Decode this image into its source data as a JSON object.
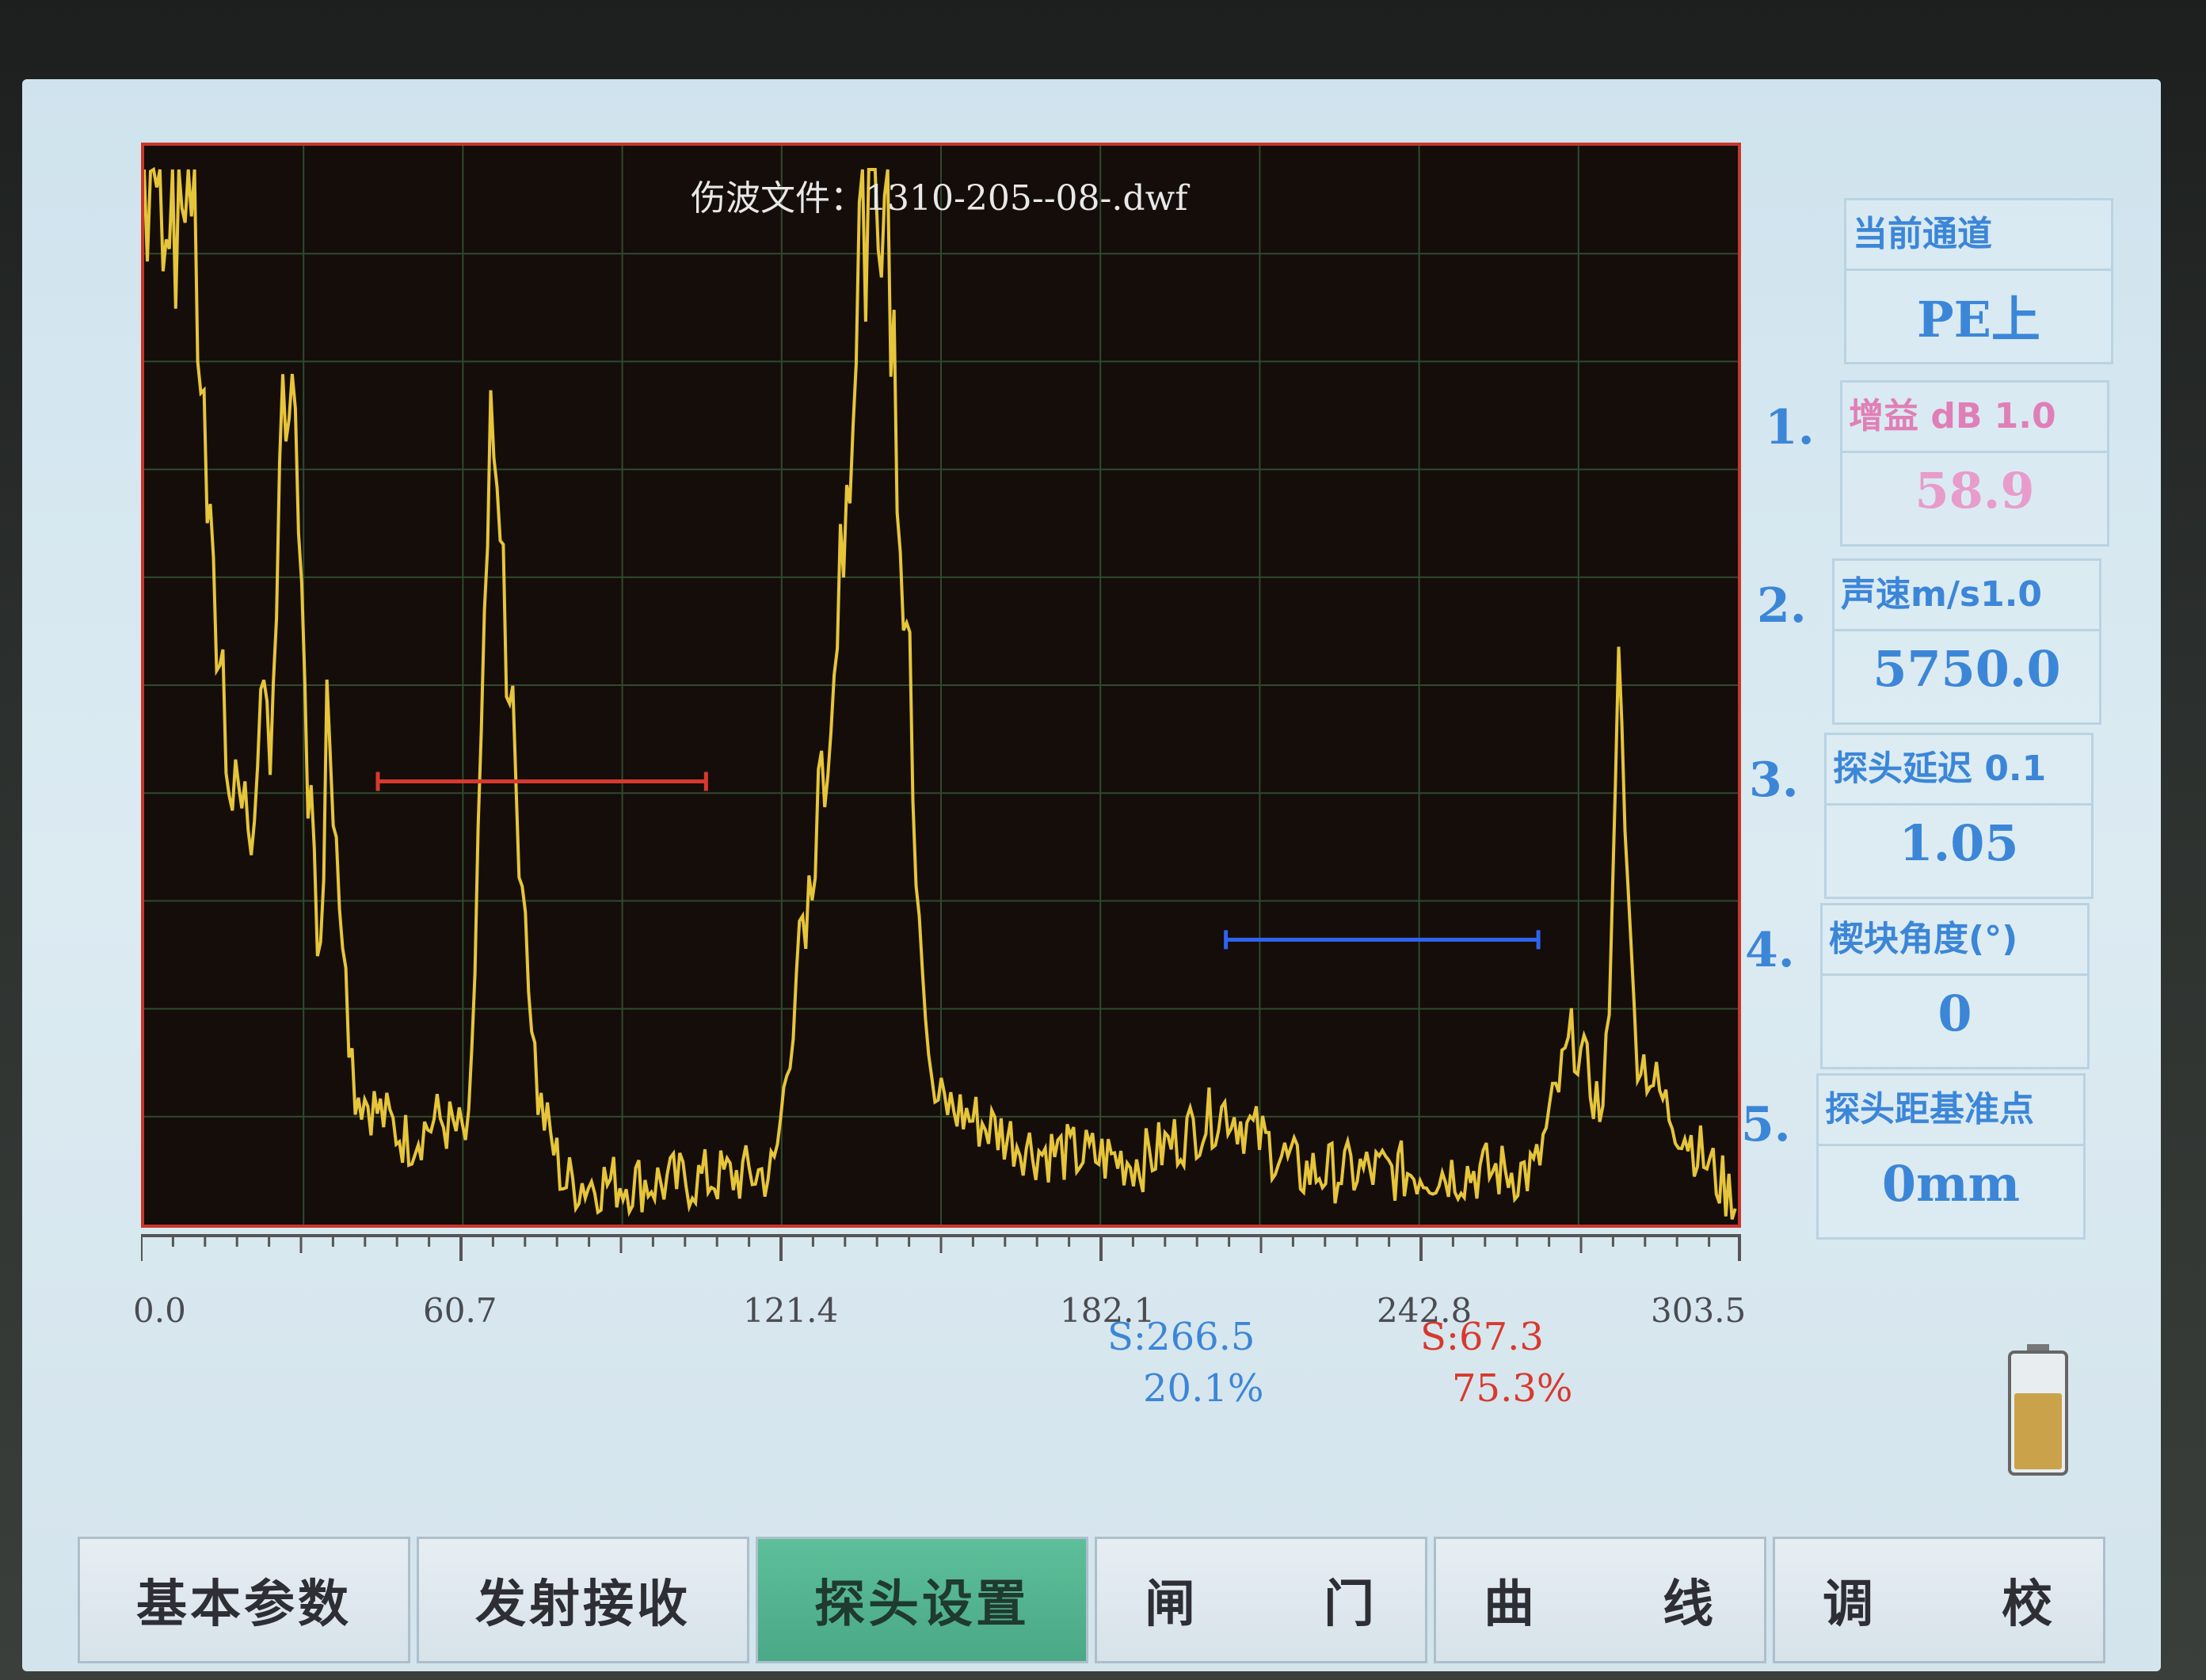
{
  "plot": {
    "file_title": "伤波文件：1310-205--08-.dwf",
    "colors": {
      "background": "#140d0a",
      "grid": "#2f4a2f",
      "trace": "#e6c53a",
      "gate_a": "#d8392e",
      "gate_b": "#2f63f0",
      "border": "#c8372c"
    }
  },
  "chart_data": {
    "type": "line",
    "title": "伤波文件：1310-205--08-.dwf",
    "xlim": [
      0,
      303.5
    ],
    "ylim": [
      0,
      100
    ],
    "ticks": [
      "0.0",
      "60.7",
      "121.4",
      "182.1",
      "242.8",
      "303.5"
    ],
    "peaks": [
      {
        "x": 2,
        "y": 100
      },
      {
        "x": 9,
        "y": 100
      },
      {
        "x": 13,
        "y": 60
      },
      {
        "x": 17,
        "y": 42
      },
      {
        "x": 20,
        "y": 38
      },
      {
        "x": 24,
        "y": 48
      },
      {
        "x": 27,
        "y": 80
      },
      {
        "x": 29,
        "y": 70
      },
      {
        "x": 33,
        "y": 25
      },
      {
        "x": 35,
        "y": 50
      },
      {
        "x": 40,
        "y": 13
      },
      {
        "x": 50,
        "y": 8
      },
      {
        "x": 56,
        "y": 10
      },
      {
        "x": 62,
        "y": 8
      },
      {
        "x": 66,
        "y": 73
      },
      {
        "x": 68,
        "y": 62
      },
      {
        "x": 75,
        "y": 12
      },
      {
        "x": 80,
        "y": 4
      },
      {
        "x": 100,
        "y": 4
      },
      {
        "x": 120,
        "y": 5
      },
      {
        "x": 131,
        "y": 50
      },
      {
        "x": 137,
        "y": 100
      },
      {
        "x": 141,
        "y": 100
      },
      {
        "x": 147,
        "y": 38
      },
      {
        "x": 150,
        "y": 12
      },
      {
        "x": 170,
        "y": 7
      },
      {
        "x": 190,
        "y": 6
      },
      {
        "x": 206,
        "y": 11
      },
      {
        "x": 220,
        "y": 5
      },
      {
        "x": 265,
        "y": 5
      },
      {
        "x": 272,
        "y": 18
      },
      {
        "x": 278,
        "y": 10
      },
      {
        "x": 281,
        "y": 52
      },
      {
        "x": 284,
        "y": 17
      },
      {
        "x": 290,
        "y": 11
      },
      {
        "x": 296,
        "y": 7
      },
      {
        "x": 303,
        "y": 2
      }
    ],
    "gates": [
      {
        "name": "A",
        "color": "#d8392e",
        "start": 44.5,
        "end": 107,
        "level": 42
      },
      {
        "name": "B",
        "color": "#2f63f0",
        "start": 206,
        "end": 265.5,
        "level": 27
      }
    ]
  },
  "readouts": {
    "b_s": "S:266.5",
    "b_pct": "20.1%",
    "a_s": "S:67.3",
    "a_pct": "75.3%",
    "b_color": "#3c86d8",
    "a_color": "#d8392e"
  },
  "panel": {
    "channel_title": "当前通道",
    "channel_value": "PE上",
    "items": [
      {
        "num": "1.",
        "title": "增益 dB 1.0",
        "value": "58.9",
        "title_color": "#e07fb7",
        "value_color": "#e89ccb"
      },
      {
        "num": "2.",
        "title": "声速m/s1.0",
        "value": "5750.0",
        "title_color": "#3c86d8",
        "value_color": "#3c86d8"
      },
      {
        "num": "3.",
        "title": "探头延迟 0.1",
        "value": "1.05",
        "title_color": "#3c86d8",
        "value_color": "#3c86d8"
      },
      {
        "num": "4.",
        "title": "楔块角度(°)",
        "value": "0",
        "title_color": "#3c86d8",
        "value_color": "#3c86d8"
      },
      {
        "num": "5.",
        "title": "探头距基准点",
        "value": "0mm",
        "title_color": "#3c86d8",
        "value_color": "#3c86d8"
      }
    ]
  },
  "battery": {
    "icon": "battery-icon",
    "level": 0.8
  },
  "tabs": [
    {
      "label": "基本参数"
    },
    {
      "label": "发射接收"
    },
    {
      "label": "探头设置"
    },
    {
      "left": "闸",
      "right": "门"
    },
    {
      "left": "曲",
      "right": "线"
    },
    {
      "left": "调",
      "right": "校"
    }
  ]
}
